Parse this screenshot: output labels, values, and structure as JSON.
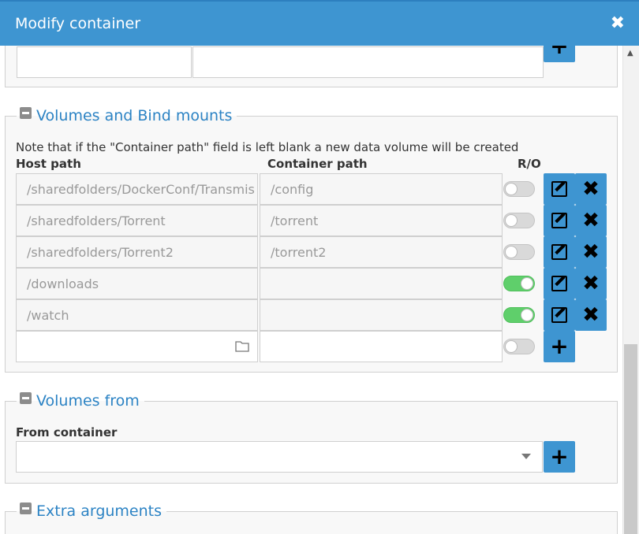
{
  "window": {
    "title": "Modify container",
    "close_icon": "close-icon"
  },
  "volumes": {
    "legend": "Volumes and Bind mounts",
    "note": "Note that if the \"Container path\" field is left blank a new data volume will be created",
    "headers": {
      "host": "Host path",
      "container": "Container path",
      "ro": "R/O"
    },
    "rows": [
      {
        "host": "/sharedfolders/DockerConf/Transmis",
        "container": "/config",
        "ro": false
      },
      {
        "host": "/sharedfolders/Torrent",
        "container": "/torrent",
        "ro": false
      },
      {
        "host": "/sharedfolders/Torrent2",
        "container": "/torrent2",
        "ro": false
      },
      {
        "host": "/downloads",
        "container": "",
        "ro": true
      },
      {
        "host": "/watch",
        "container": "",
        "ro": true
      }
    ],
    "new_row": {
      "host": "",
      "container": "",
      "ro": false
    }
  },
  "volumes_from": {
    "legend": "Volumes from",
    "label": "From container",
    "selected": ""
  },
  "extra_arguments": {
    "legend": "Extra arguments"
  },
  "colors": {
    "accent": "#3e95d1",
    "toggle_on": "#5fcf6b",
    "legend": "#2c83c4"
  }
}
